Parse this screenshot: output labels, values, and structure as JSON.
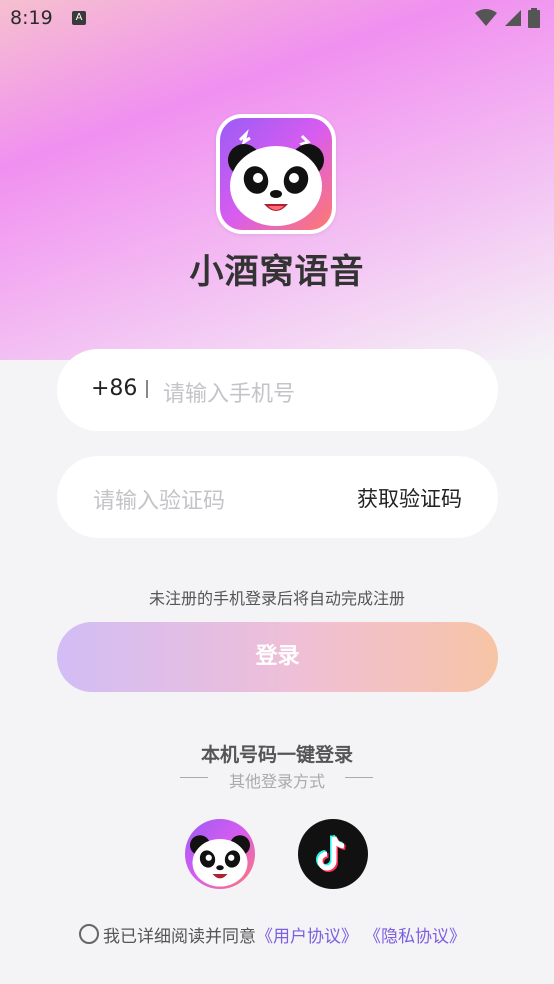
{
  "status_bar": {
    "time": "8:19",
    "notification_icon": "A"
  },
  "app": {
    "name": "小酒窝语音"
  },
  "phone_field": {
    "prefix": "+86",
    "placeholder": "请输入手机号"
  },
  "code_field": {
    "placeholder": "请输入验证码",
    "get_code_label": "获取验证码"
  },
  "hint": "未注册的手机登录后将自动完成注册",
  "login_button": "登录",
  "one_click_login": "本机号码一键登录",
  "other_login": "其他登录方式",
  "social": [
    {
      "name": "panda-app-login",
      "icon": "panda-icon"
    },
    {
      "name": "tiktok-login",
      "icon": "tiktok-icon"
    }
  ],
  "agreement": {
    "prefix": "我已详细阅读并同意",
    "user_agreement": "《用户协议》",
    "privacy_agreement": "《隐私协议》"
  },
  "colors": {
    "accent_link": "#7b5fe0",
    "button_gradient_start": "#d2bdf5",
    "button_gradient_end": "#f7c4a5"
  }
}
